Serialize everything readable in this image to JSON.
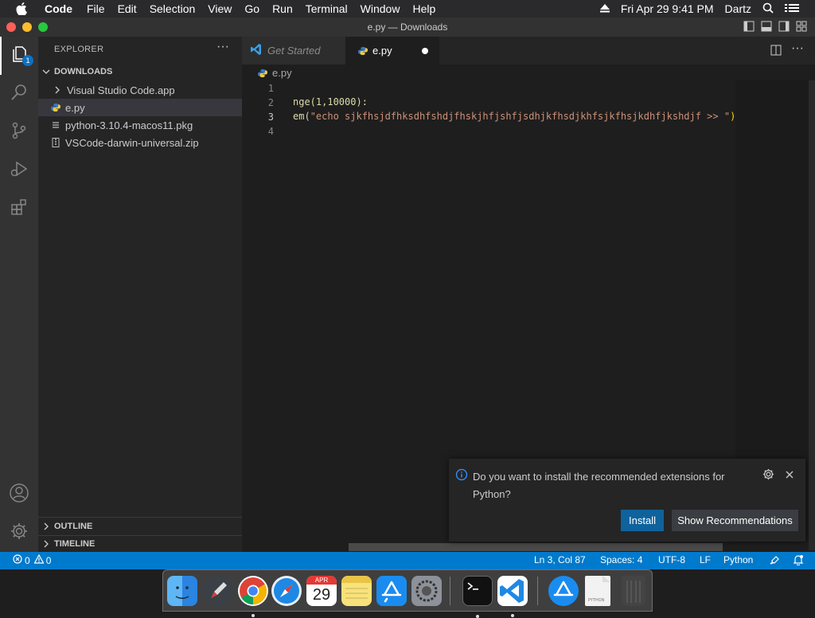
{
  "menubar": {
    "app": "Code",
    "items": [
      "File",
      "Edit",
      "Selection",
      "View",
      "Go",
      "Run",
      "Terminal",
      "Window",
      "Help"
    ],
    "datetime": "Fri Apr 29  9:41 PM",
    "user": "Dartz"
  },
  "window": {
    "title": "e.py — Downloads"
  },
  "activity": {
    "explorer_badge": "1"
  },
  "sidebar": {
    "title": "EXPLORER",
    "more": "···",
    "folder": "DOWNLOADS",
    "items": [
      {
        "label": "Visual Studio Code.app"
      },
      {
        "label": "e.py"
      },
      {
        "label": "python-3.10.4-macos11.pkg"
      },
      {
        "label": "VSCode-darwin-universal.zip"
      }
    ],
    "outline": "OUTLINE",
    "timeline": "TIMELINE"
  },
  "tabs": [
    {
      "label": "Get Started"
    },
    {
      "label": "e.py"
    }
  ],
  "breadcrumb": "e.py",
  "editor": {
    "line_numbers": [
      "1",
      "2",
      "3",
      "4"
    ],
    "line2": "nge(1,10000):",
    "line3_prefix": "em(",
    "line3_string": "\"echo sjkfhsjdfhksdhfshdjfhskjhfjshfjsdhjkfhsdjkhfsjkfhsjkdhfjkshdjf >> \"",
    "line3_suffix": ")"
  },
  "notification": {
    "message": "Do you want to install the recommended extensions for Python?",
    "install": "Install",
    "show": "Show Recommendations"
  },
  "statusbar": {
    "errors": "0",
    "warnings": "0",
    "position": "Ln 3, Col 87",
    "spaces": "Spaces: 4",
    "encoding": "UTF-8",
    "eol": "LF",
    "language": "Python"
  },
  "dock": {
    "calendar_month": "APR",
    "calendar_day": "29"
  },
  "colors": {
    "accent": "#007acc",
    "button": "#0e639c",
    "string": "#ce9178",
    "function": "#dcdcaa"
  }
}
